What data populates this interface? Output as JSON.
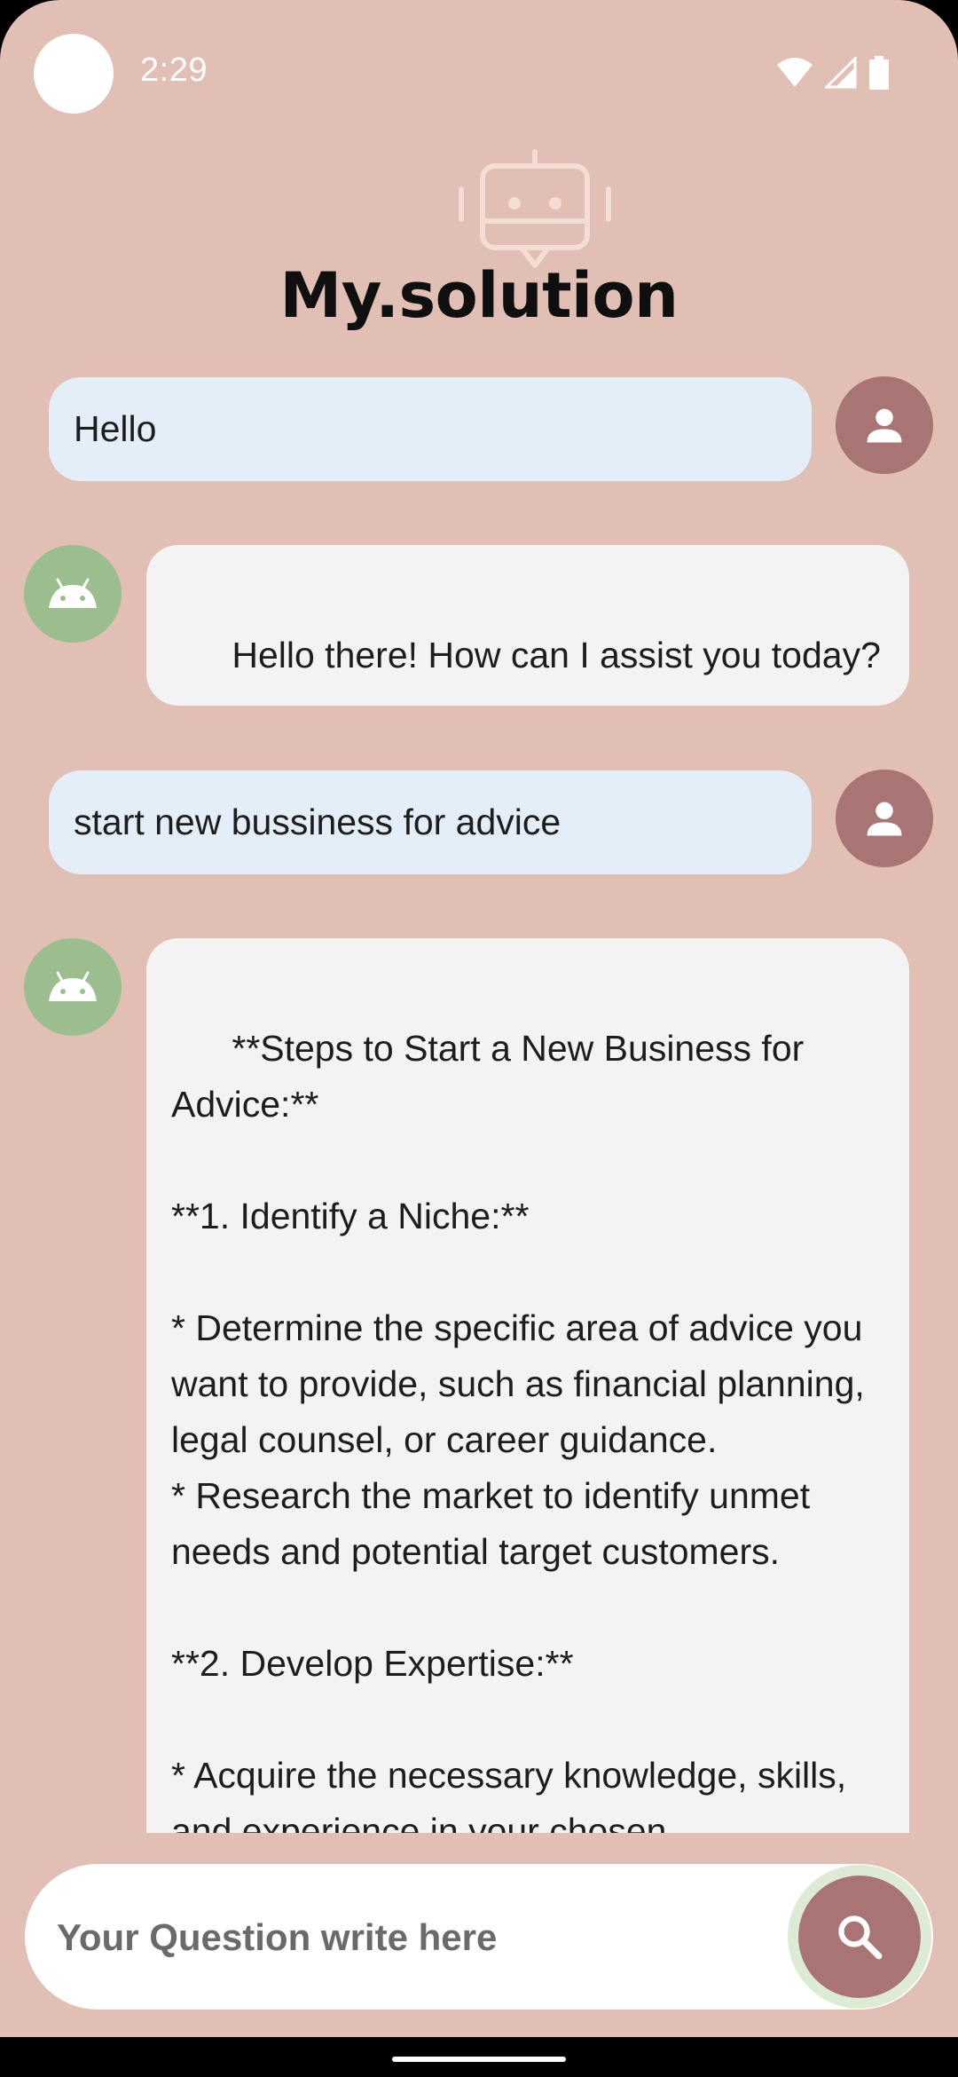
{
  "status_bar": {
    "time": "2:29"
  },
  "header": {
    "title": "My.solution",
    "logo_icon": "robot-chat-icon"
  },
  "messages": [
    {
      "role": "user",
      "text": "Hello"
    },
    {
      "role": "bot",
      "text": "Hello there! How can I assist you today?"
    },
    {
      "role": "user",
      "text": "start new bussiness for advice"
    },
    {
      "role": "bot",
      "text": "**Steps to Start a New Business for Advice:**\n\n**1. Identify a Niche:**\n\n* Determine the specific area of advice you want to provide, such as financial planning, legal counsel, or career guidance.\n* Research the market to identify unmet needs and potential target customers.\n\n**2. Develop Expertise:**\n\n* Acquire the necessary knowledge, skills, and experience in your chosen"
    }
  ],
  "input": {
    "placeholder": "Your Question write here",
    "value": ""
  },
  "icons": {
    "user_avatar": "person-icon",
    "bot_avatar": "android-icon",
    "send": "search-icon"
  },
  "colors": {
    "background": "#E1BFB4",
    "user_bubble": "#E3EEF9",
    "bot_bubble": "#F4F3F3",
    "user_avatar": "#A97474",
    "bot_avatar": "#9BBE8E",
    "accent": "#A97474"
  }
}
